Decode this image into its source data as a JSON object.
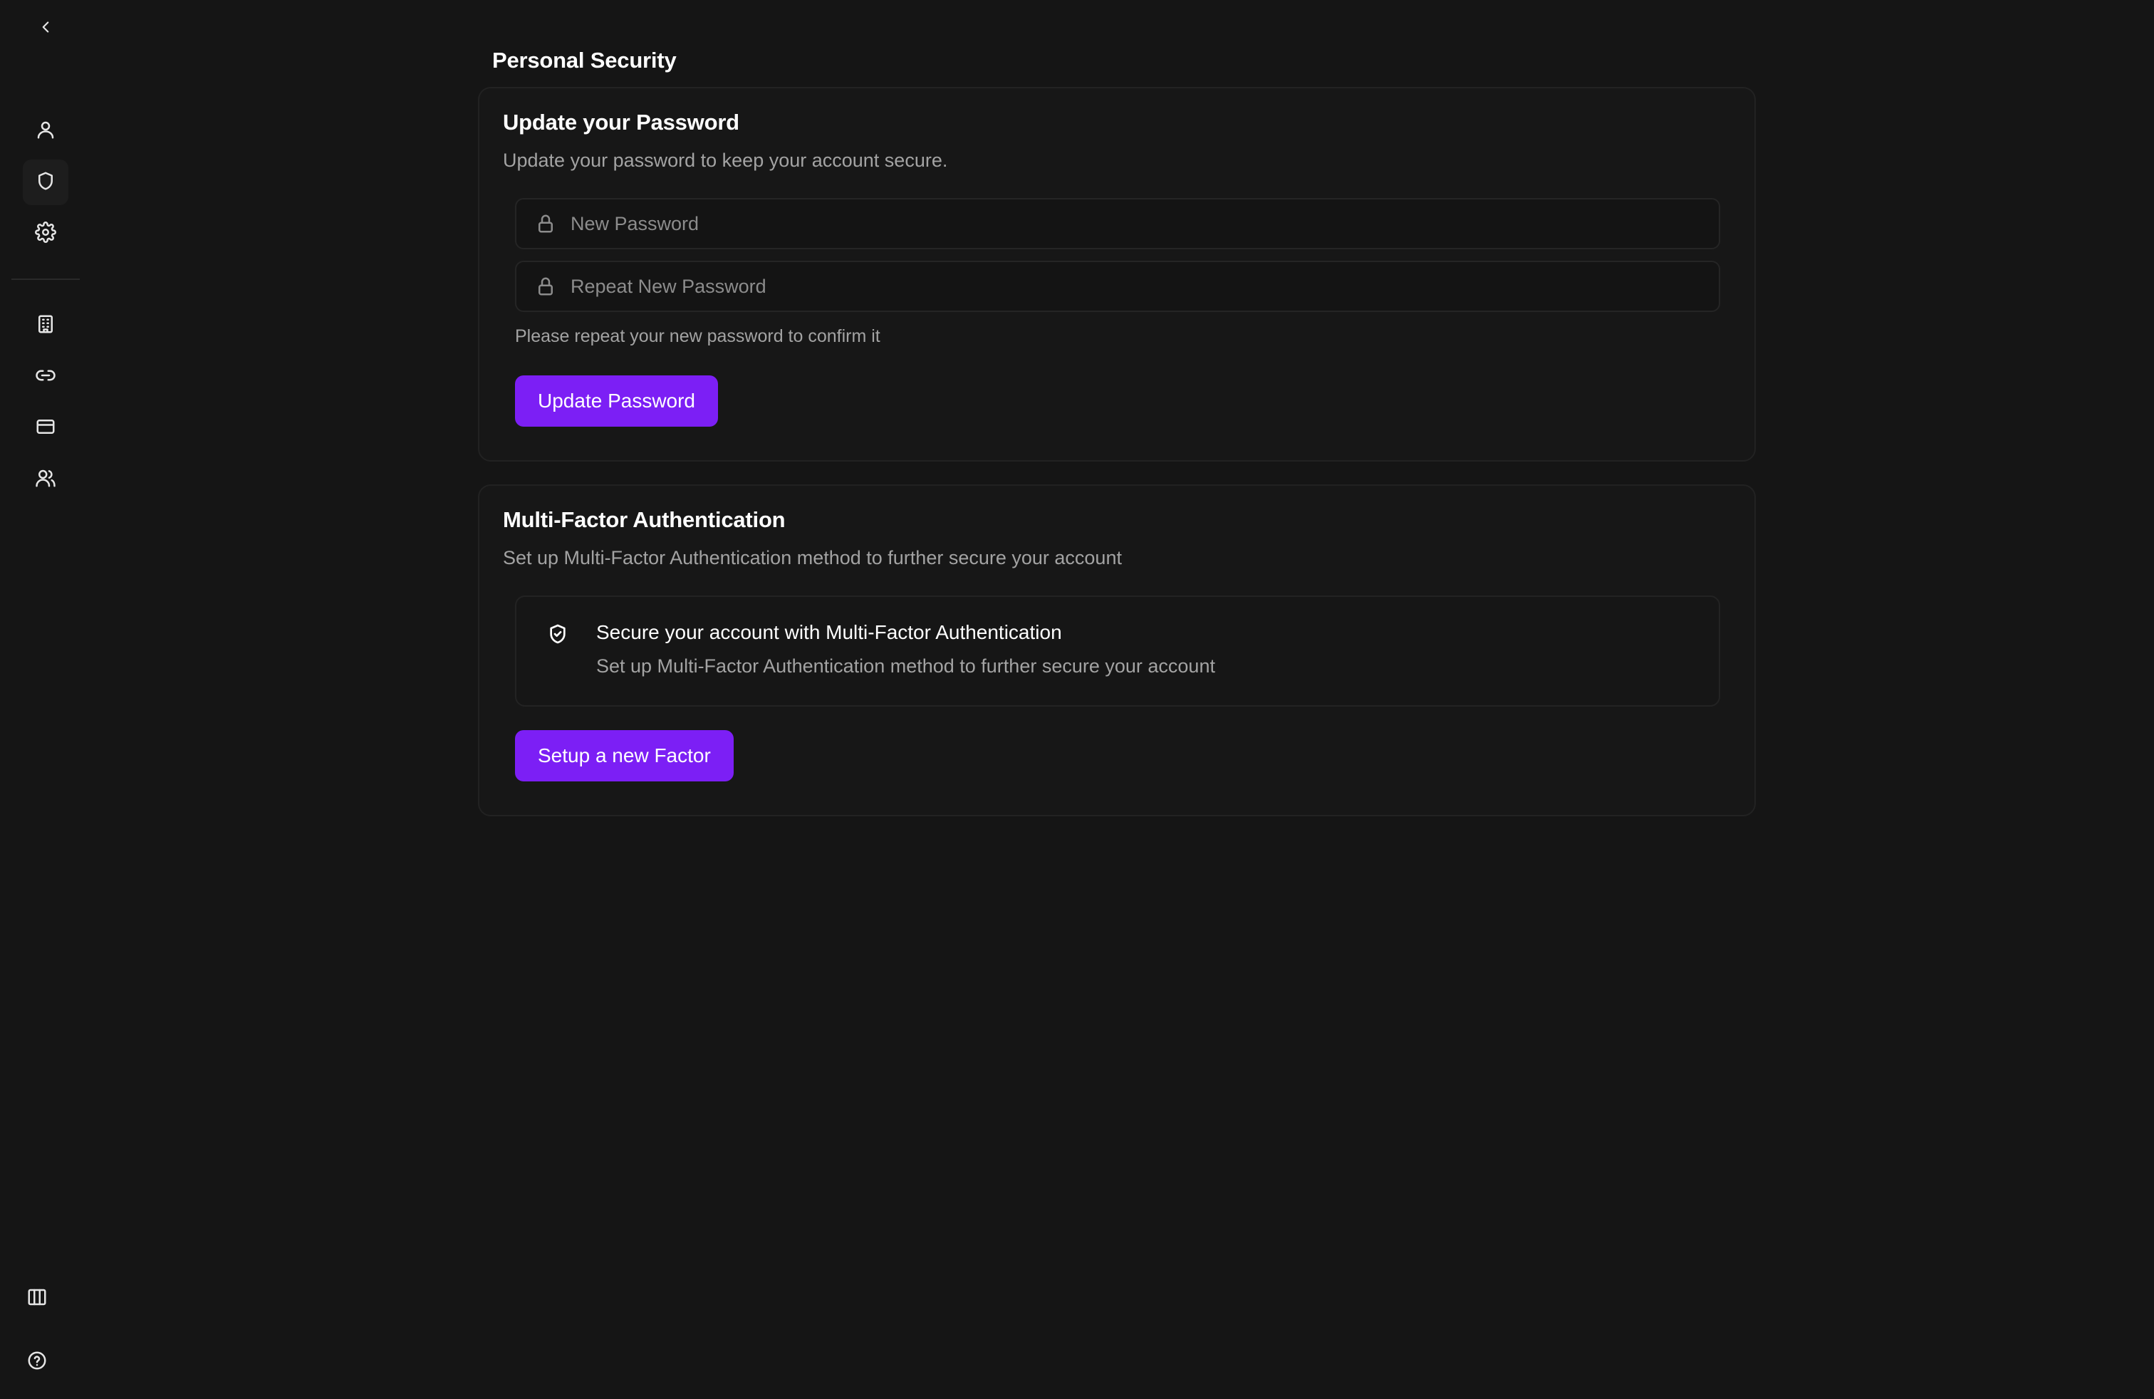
{
  "page": {
    "title": "Personal Security"
  },
  "sidebar": {
    "collapse_icon": "chevron-left-icon",
    "items": [
      {
        "name": "profile",
        "icon": "user-icon"
      },
      {
        "name": "security",
        "icon": "shield-icon",
        "active": true
      },
      {
        "name": "settings",
        "icon": "gear-icon"
      },
      {
        "name": "organization",
        "icon": "building-icon"
      },
      {
        "name": "links",
        "icon": "link-icon"
      },
      {
        "name": "billing",
        "icon": "credit-card-icon"
      },
      {
        "name": "members",
        "icon": "users-icon"
      }
    ],
    "bottom_items": [
      {
        "name": "layout-toggle",
        "icon": "columns-icon"
      },
      {
        "name": "help",
        "icon": "help-circle-icon"
      }
    ]
  },
  "password_card": {
    "title": "Update your Password",
    "description": "Update your password to keep your account secure.",
    "new_password_placeholder": "New Password",
    "repeat_password_placeholder": "Repeat New Password",
    "helper_text": "Please repeat your new password to confirm it",
    "submit_label": "Update Password"
  },
  "mfa_card": {
    "title": "Multi-Factor Authentication",
    "description": "Set up Multi-Factor Authentication method to further secure your account",
    "notice_title": "Secure your account with Multi-Factor Authentication",
    "notice_description": "Set up Multi-Factor Authentication method to further secure your account",
    "setup_label": "Setup a new Factor"
  },
  "colors": {
    "background": "#151515",
    "card_background": "#171717",
    "accent": "#7c1ff5",
    "muted_text": "#a3a3a3"
  }
}
